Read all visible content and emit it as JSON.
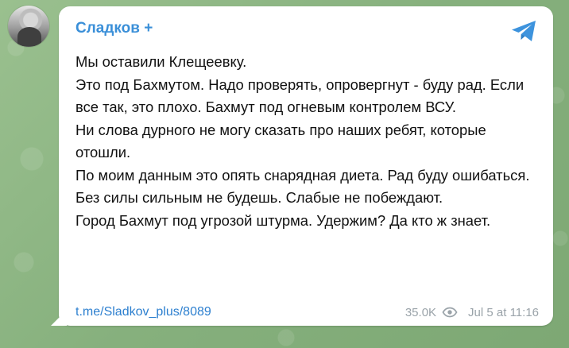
{
  "channel": {
    "name": "Сладков +",
    "avatar_icon": "profile-photo",
    "share_icon": "telegram-share-icon"
  },
  "message": {
    "lines": [
      "Мы оставили Клещеевку.",
      "Это под Бахмутом. Надо проверять, опровергнут - буду рад. Если все так, это плохо. Бахмут под огневым контролем ВСУ.",
      "Ни слова дурного не могу сказать про наших ребят, которые отошли.",
      "По моим данным это опять снарядная диета. Рад буду ошибаться.",
      "Без силы сильным не будешь. Слабые не побеждают.",
      "Город Бахмут под угрозой штурма. Удержим? Да кто ж знает."
    ]
  },
  "footer": {
    "link": "t.me/Sladkov_plus/8089",
    "views": "35.0K",
    "views_icon": "eye-icon",
    "date": "Jul 5 at 11:16"
  },
  "colors": {
    "accent": "#3a8fd8",
    "link": "#2c7fcf",
    "meta": "#9aa3a9",
    "background": "#8fb58a"
  }
}
